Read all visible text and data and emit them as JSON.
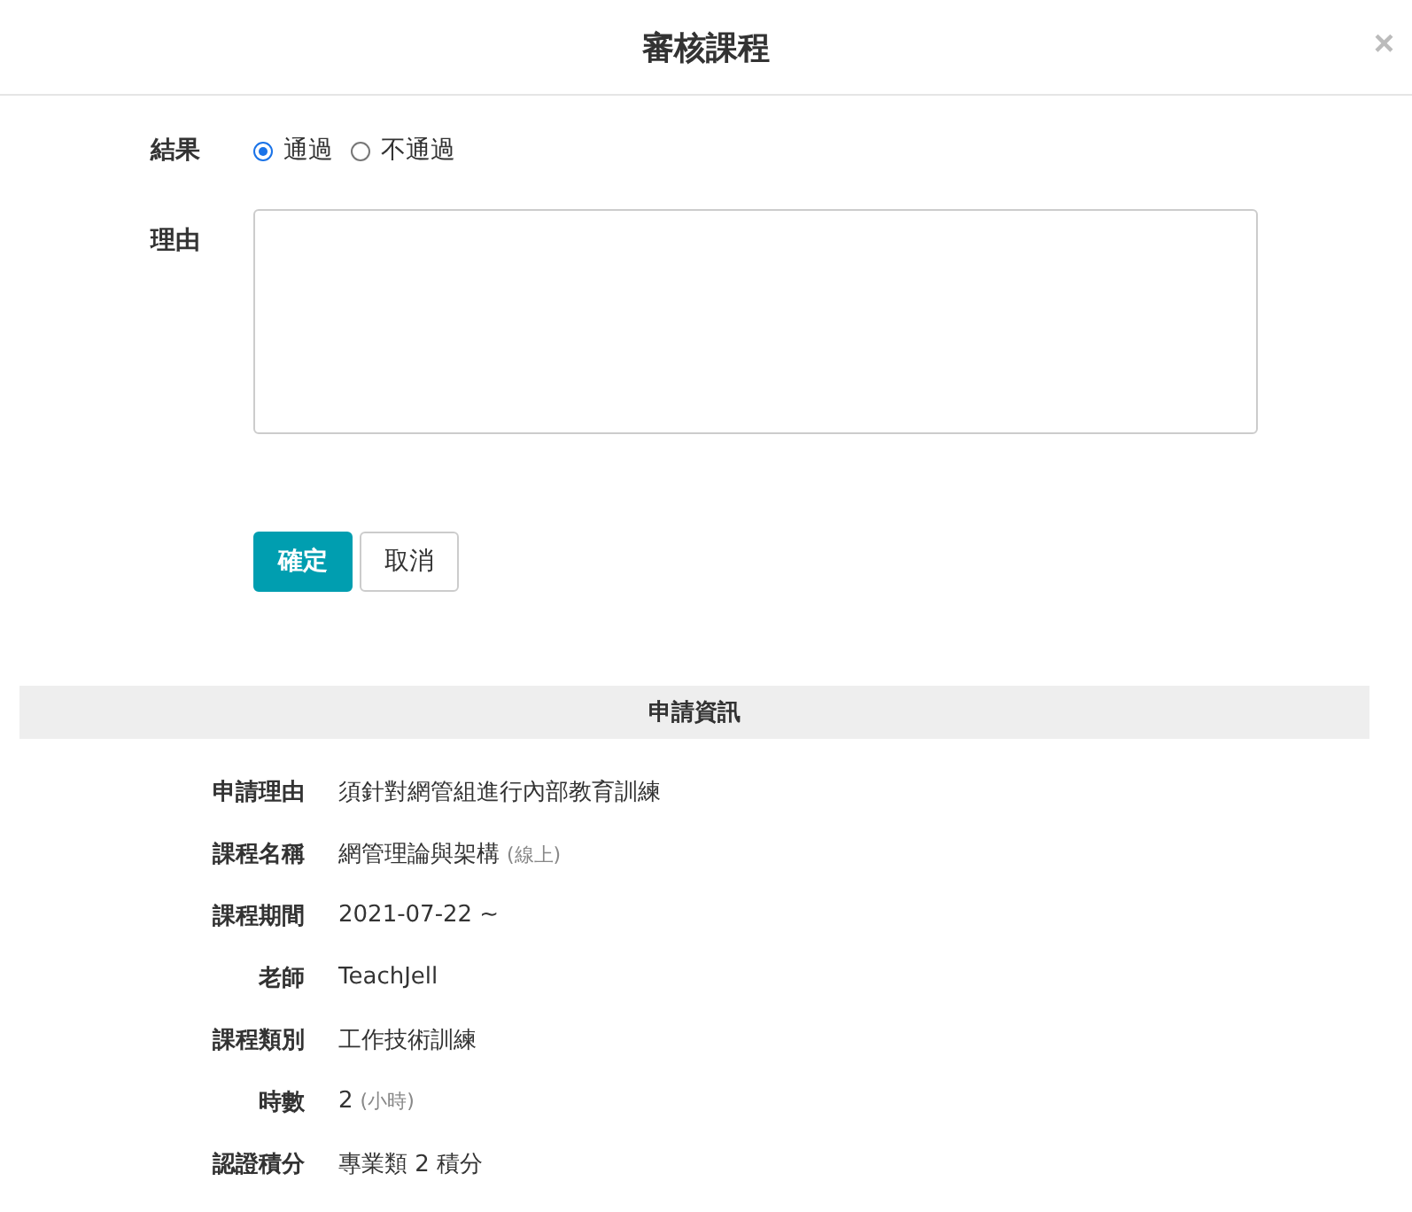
{
  "dialog": {
    "title": "審核課程",
    "close": "×"
  },
  "form": {
    "result_label": "結果",
    "options": [
      {
        "label": "通過",
        "selected": true
      },
      {
        "label": "不通過",
        "selected": false
      }
    ],
    "reason_label": "理由",
    "buttons": [
      {
        "label": "確定",
        "kind": "primary"
      },
      {
        "label": "取消",
        "kind": "default"
      }
    ]
  },
  "info": {
    "title": "申請資訊",
    "rows": [
      {
        "label": "申請理由",
        "value": "須針對網管組進行內部教育訓練"
      },
      {
        "label": "課程名稱",
        "value": "網管理論與架構",
        "note": "(線上)"
      },
      {
        "label": "課程期間",
        "value": "2021-07-22 ~"
      },
      {
        "label": "老師",
        "value": "TeachJell"
      },
      {
        "label": "課程類別",
        "value": "工作技術訓練"
      },
      {
        "label": "時數",
        "value": "2",
        "note": "(小時)"
      },
      {
        "label": "認證積分",
        "value": "專業類 2 積分"
      }
    ]
  }
}
